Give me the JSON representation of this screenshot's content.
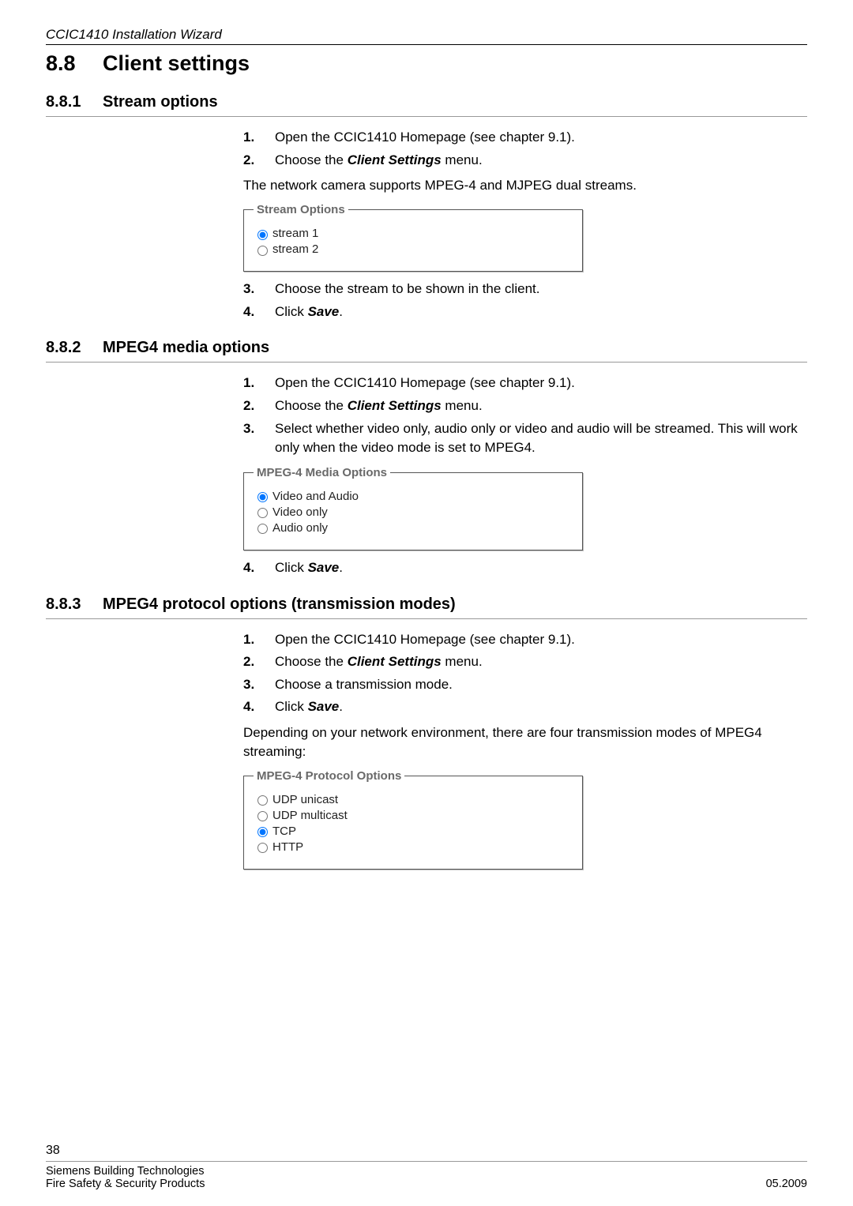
{
  "header": {
    "running_title": "CCIC1410 Installation Wizard"
  },
  "section": {
    "number": "8.8",
    "title": "Client settings"
  },
  "s881": {
    "number": "8.8.1",
    "title": "Stream options",
    "steps": {
      "n1": "1.",
      "t1": "Open the CCIC1410 Homepage (see chapter 9.1).",
      "n2": "2.",
      "t2_pre": "Choose the ",
      "t2_b": "Client Settings",
      "t2_post": " menu."
    },
    "note": "The network camera supports MPEG-4 and MJPEG dual streams.",
    "fieldset_legend": "Stream Options",
    "radio1": "stream 1",
    "radio2": "stream 2",
    "steps2": {
      "n3": "3.",
      "t3": "Choose the stream to be shown in the client.",
      "n4": "4.",
      "t4_pre": "Click ",
      "t4_b": "Save",
      "t4_post": "."
    }
  },
  "s882": {
    "number": "8.8.2",
    "title": "MPEG4 media options",
    "steps": {
      "n1": "1.",
      "t1": "Open the CCIC1410 Homepage (see chapter 9.1).",
      "n2": "2.",
      "t2_pre": "Choose the ",
      "t2_b": "Client Settings",
      "t2_post": " menu.",
      "n3": "3.",
      "t3": "Select whether video only, audio only or video and audio will be streamed. This will work only when the video mode is set to MPEG4."
    },
    "fieldset_legend": "MPEG-4 Media Options",
    "radio1": "Video and Audio",
    "radio2": "Video only",
    "radio3": "Audio only",
    "steps2": {
      "n4": "4.",
      "t4_pre": "Click ",
      "t4_b": "Save",
      "t4_post": "."
    }
  },
  "s883": {
    "number": "8.8.3",
    "title": "MPEG4 protocol options (transmission modes)",
    "steps": {
      "n1": "1.",
      "t1": "Open the CCIC1410 Homepage (see chapter 9.1).",
      "n2": "2.",
      "t2_pre": "Choose the ",
      "t2_b": "Client Settings",
      "t2_post": " menu.",
      "n3": "3.",
      "t3": "Choose a transmission mode.",
      "n4": "4.",
      "t4_pre": "Click ",
      "t4_b": "Save",
      "t4_post": "."
    },
    "note": "Depending on your network environment, there are four transmission modes of MPEG4 streaming:",
    "fieldset_legend": "MPEG-4 Protocol Options",
    "radio1": "UDP unicast",
    "radio2": "UDP multicast",
    "radio3": "TCP",
    "radio4": "HTTP"
  },
  "footer": {
    "page": "38",
    "org1": "Siemens Building Technologies",
    "org2": "Fire Safety & Security Products",
    "date": "05.2009"
  }
}
